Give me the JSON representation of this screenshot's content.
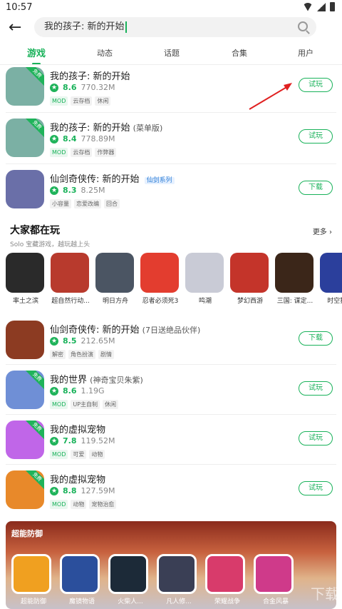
{
  "status": {
    "time": "10:57"
  },
  "search": {
    "value": "我的孩子: 新的开始"
  },
  "tabs": [
    "游戏",
    "动态",
    "话题",
    "合集",
    "用户"
  ],
  "apps_top": [
    {
      "title": "我的孩子: 新的开始",
      "subtitle": "",
      "badge": "",
      "score": "8.6",
      "size": "770.32M",
      "tags": [
        "MOD",
        "云存档",
        "休闲"
      ],
      "button": "试玩",
      "ribbon": "免费",
      "icon_color": "#7bb0a4"
    },
    {
      "title": "我的孩子: 新的开始",
      "subtitle": "(菜单版)",
      "badge": "",
      "score": "8.4",
      "size": "778.89M",
      "tags": [
        "MOD",
        "云存档",
        "作弊器"
      ],
      "button": "试玩",
      "ribbon": "免费",
      "icon_color": "#7bb0a4"
    },
    {
      "title": "仙剑奇侠传: 新的开始",
      "subtitle": "",
      "badge": "仙剑系列",
      "score": "8.3",
      "size": "8.25M",
      "tags": [
        "小容量",
        "恋爱改编",
        "回合"
      ],
      "button": "下载",
      "ribbon": "",
      "icon_color": "#6a6fa8"
    }
  ],
  "section": {
    "title": "大家都在玩",
    "subtitle": "Solo 宝藏游戏，越玩越上头",
    "more": "更多"
  },
  "popular": [
    {
      "label": "率土之滨",
      "color": "#2a2a2a"
    },
    {
      "label": "超自然行动...",
      "color": "#b83a2d"
    },
    {
      "label": "明日方舟",
      "color": "#4b5563"
    },
    {
      "label": "忍者必须死3",
      "color": "#e33d2f"
    },
    {
      "label": "鸣潮",
      "color": "#c9cbd6"
    },
    {
      "label": "梦幻西游",
      "color": "#c4342a"
    },
    {
      "label": "三国: 谋定...",
      "color": "#3b2619"
    },
    {
      "label": "时空猎...",
      "color": "#2b3f9c"
    }
  ],
  "apps_bottom": [
    {
      "title": "仙剑奇侠传: 新的开始",
      "subtitle": "(7日送绝品伙伴)",
      "badge": "",
      "score": "8.5",
      "size": "212.65M",
      "tags": [
        "解密",
        "角色扮演",
        "剧情"
      ],
      "button": "下载",
      "ribbon": "",
      "icon_color": "#8c3b22"
    },
    {
      "title": "我的世界",
      "subtitle": "(神奇宝贝朱紫)",
      "badge": "",
      "score": "8.6",
      "size": "1.19G",
      "tags": [
        "MOD",
        "UP主自制",
        "休闲"
      ],
      "button": "试玩",
      "ribbon": "免费",
      "icon_color": "#6f8fd6"
    },
    {
      "title": "我的虚拟宠物",
      "subtitle": "",
      "badge": "",
      "score": "7.8",
      "size": "119.52M",
      "tags": [
        "MOD",
        "可爱",
        "动物"
      ],
      "button": "试玩",
      "ribbon": "免费",
      "icon_color": "#c066e8"
    },
    {
      "title": "我的虚拟宠物",
      "subtitle": "",
      "badge": "",
      "score": "8.8",
      "size": "127.59M",
      "tags": [
        "MOD",
        "动物",
        "宠物治愈"
      ],
      "button": "试玩",
      "ribbon": "免费",
      "icon_color": "#e8892a"
    }
  ],
  "banner": {
    "title": "超能防御",
    "games": [
      {
        "label": "超能防御",
        "color": "#f0a020"
      },
      {
        "label": "魔镜物语",
        "color": "#2b4f9c"
      },
      {
        "label": "火柴人...",
        "color": "#1c2a38"
      },
      {
        "label": "凡人修...",
        "color": "#3a3f55"
      },
      {
        "label": "荣耀战争",
        "color": "#d83b6b"
      },
      {
        "label": "合金风暴",
        "color": "#cf3a8a"
      }
    ]
  },
  "watermark": "下载"
}
